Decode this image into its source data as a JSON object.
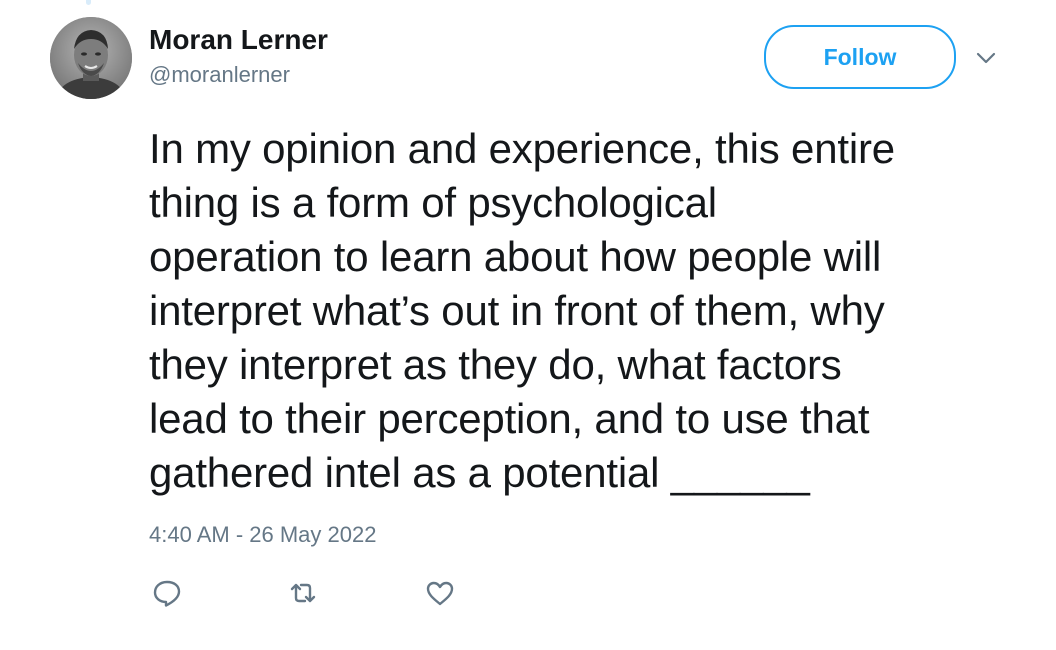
{
  "author": {
    "display_name": "Moran Lerner",
    "handle": "@moranlerner"
  },
  "header": {
    "follow_label": "Follow",
    "menu_icon": "chevron-down-icon"
  },
  "tweet": {
    "text_lines": [
      "In my opinion and experience, this entire",
      "thing is a form of psychological",
      "operation to learn about how people will",
      "interpret what’s out in front of them, why",
      "they interpret as they do, what factors",
      "lead to their perception, and to use that",
      "gathered intel as a potential ______"
    ],
    "timestamp": "4:40 AM - 26 May 2022"
  },
  "actions": [
    {
      "icon": "reply-icon"
    },
    {
      "icon": "retweet-icon"
    },
    {
      "icon": "like-icon"
    }
  ],
  "colors": {
    "accent": "#1da1f2",
    "secondary_text": "#657786",
    "primary_text": "#14171a",
    "icon": "#657786"
  }
}
